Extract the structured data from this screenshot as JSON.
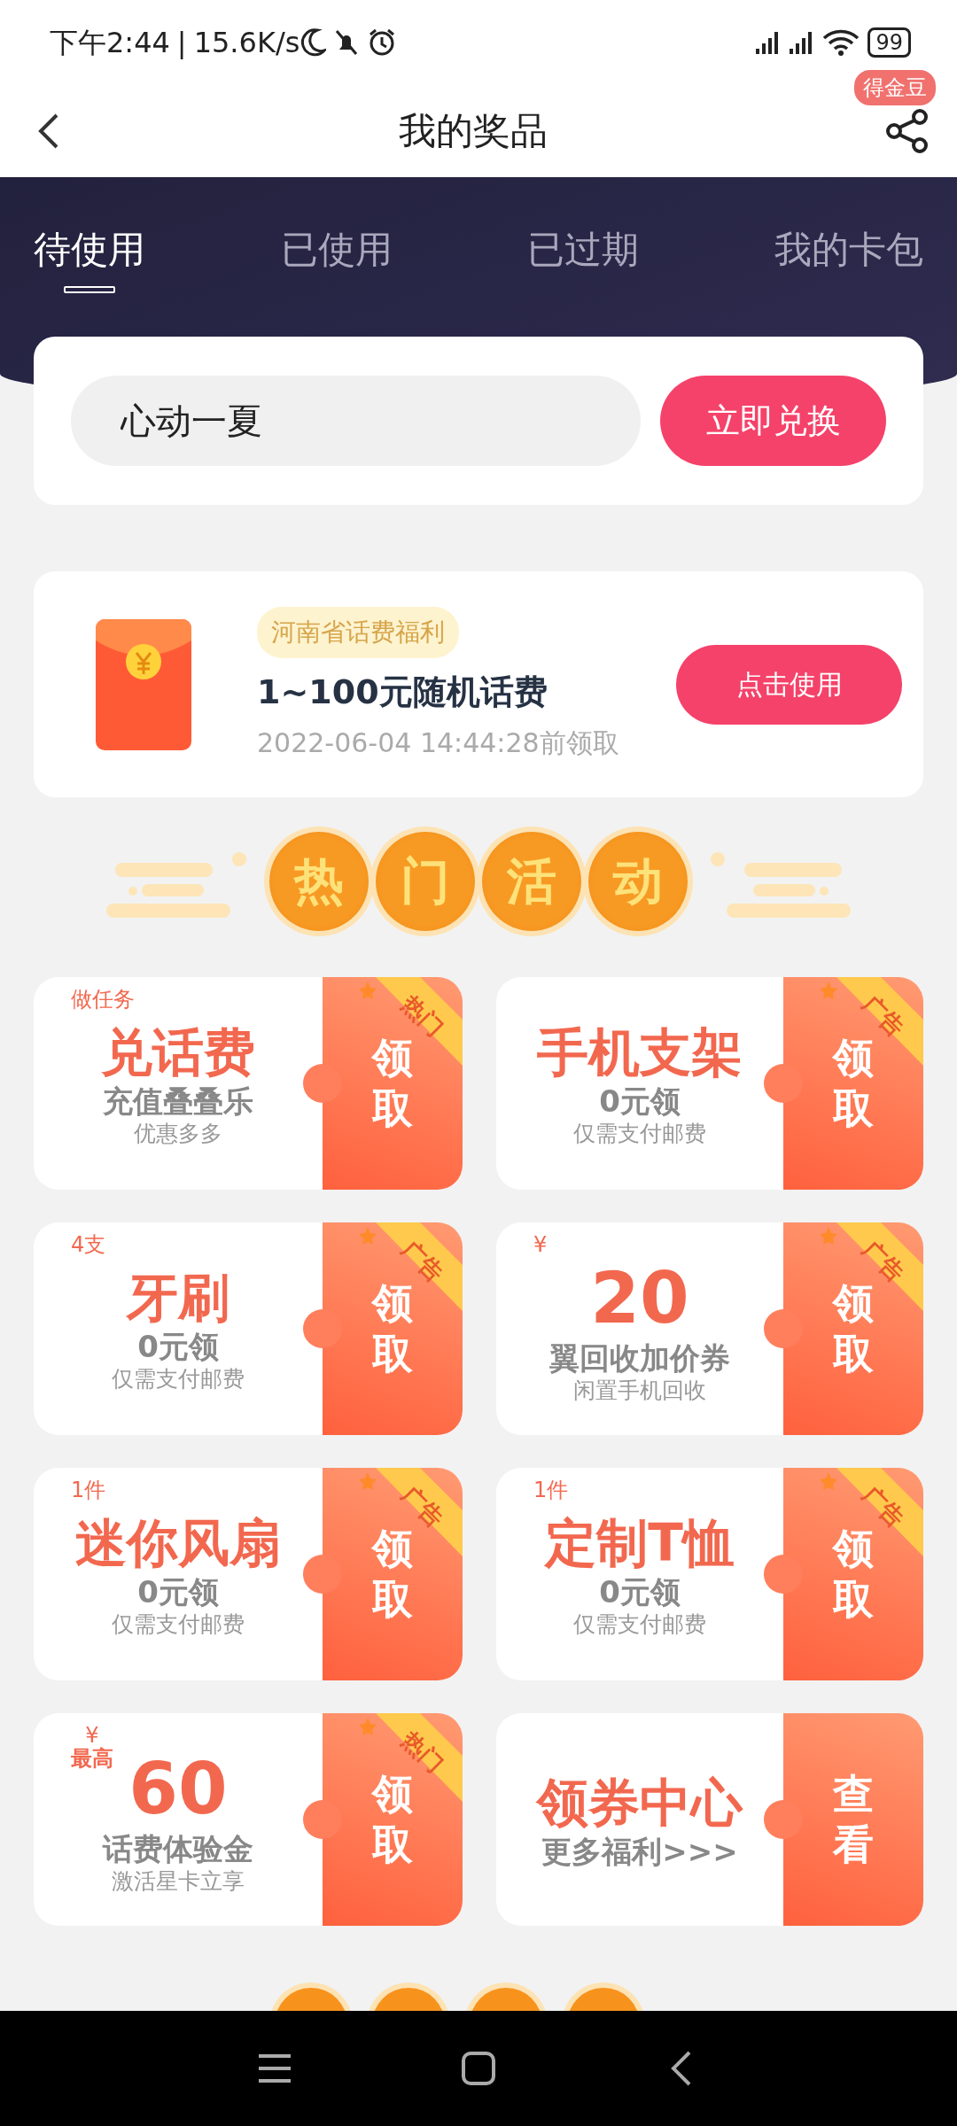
{
  "status_bar": {
    "time": "下午2:44",
    "separator": "|",
    "speed": "15.6K/s",
    "battery": "99"
  },
  "header": {
    "title": "我的奖品",
    "badge": "得金豆"
  },
  "tabs": [
    {
      "label": "待使用",
      "selected": true
    },
    {
      "label": "已使用",
      "selected": false
    },
    {
      "label": "已过期",
      "selected": false
    },
    {
      "label": "我的卡包",
      "selected": false
    }
  ],
  "redeem": {
    "value": "心动一夏",
    "button": "立即兑换"
  },
  "prize": {
    "tag": "河南省话费福利",
    "title": "1~100元随机话费",
    "deadline": "2022-06-04 14:44:28前领取",
    "button": "点击使用"
  },
  "hot_header": {
    "chars": [
      "热",
      "门",
      "活",
      "动"
    ]
  },
  "offers": [
    {
      "top_label": "做任务",
      "title": "兑话费",
      "subtitle": "充值叠叠乐",
      "note": "优惠多多",
      "ribbon": "热门",
      "action": "领取"
    },
    {
      "title": "手机支架",
      "subtitle": "0元领",
      "note": "仅需支付邮费",
      "ribbon": "广告",
      "action": "领取"
    },
    {
      "top_label": "4支",
      "title": "牙刷",
      "subtitle": "0元领",
      "note": "仅需支付邮费",
      "ribbon": "广告",
      "action": "领取"
    },
    {
      "top_label": "¥",
      "title": "20",
      "subtitle": "翼回收加价券",
      "note": "闲置手机回收",
      "ribbon": "广告",
      "action": "领取"
    },
    {
      "top_label": "1件",
      "title": "迷你风扇",
      "subtitle": "0元领",
      "note": "仅需支付邮费",
      "ribbon": "广告",
      "action": "领取"
    },
    {
      "top_label": "1件",
      "title": "定制T恤",
      "subtitle": "0元领",
      "note": "仅需支付邮费",
      "ribbon": "广告",
      "action": "领取"
    },
    {
      "top_label": "¥",
      "top_label_2": "最高",
      "title": "60",
      "subtitle": "话费体验金",
      "note": "激活星卡立享",
      "ribbon": "热门",
      "action": "领取"
    },
    {
      "title": "领券中心",
      "subtitle": "更多福利>>>",
      "action": "查看"
    }
  ]
}
